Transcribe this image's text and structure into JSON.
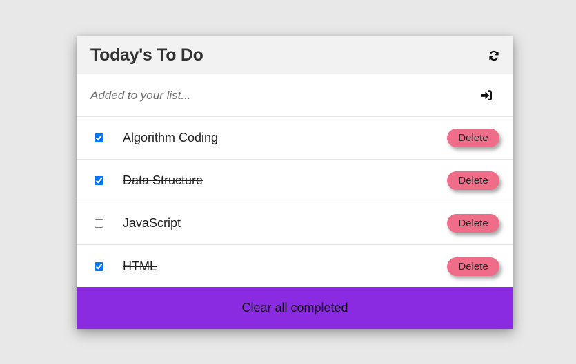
{
  "header": {
    "title": "Today's To Do",
    "refresh_icon": "sync-icon"
  },
  "add": {
    "placeholder": "Added to your list...",
    "submit_icon": "sign-in-icon"
  },
  "todos": [
    {
      "label": "Algorithm Coding",
      "completed": true,
      "delete_label": "Delete"
    },
    {
      "label": "Data Structure",
      "completed": true,
      "delete_label": "Delete"
    },
    {
      "label": "JavaScript",
      "completed": false,
      "delete_label": "Delete"
    },
    {
      "label": "HTML",
      "completed": true,
      "delete_label": "Delete"
    }
  ],
  "footer": {
    "clear_label": "Clear all completed"
  },
  "colors": {
    "accent_purple": "#8a2be2",
    "delete_pink": "#f06d8a",
    "header_bg": "#f2f2f2",
    "page_bg": "#e8e8e8"
  }
}
